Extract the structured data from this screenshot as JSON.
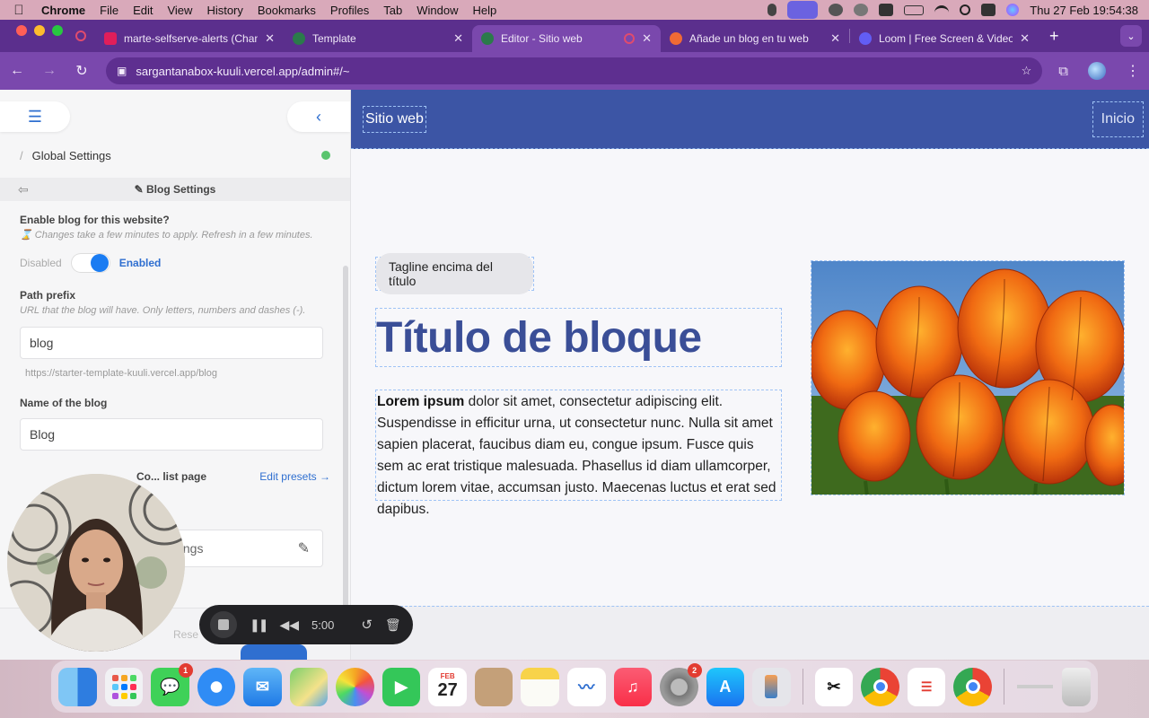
{
  "menubar": {
    "app_name": "Chrome",
    "items": [
      "File",
      "Edit",
      "View",
      "History",
      "Bookmarks",
      "Profiles",
      "Tab",
      "Window",
      "Help"
    ],
    "clock": "Thu 27 Feb  19:54:38"
  },
  "tabs": [
    {
      "title": "marte-selfserve-alerts (Chan",
      "favicon_color": "#e01e5a",
      "active": false
    },
    {
      "title": "Template",
      "favicon_color": "#2b7a4b",
      "active": false
    },
    {
      "title": "Editor - Sitio web",
      "favicon_color": "#2b7a4b",
      "active": true
    },
    {
      "title": "Añade un blog en tu web",
      "favicon_color": "#f06a35",
      "active": false
    },
    {
      "title": "Loom | Free Screen & Video R",
      "favicon_color": "#625df5",
      "active": false
    }
  ],
  "toolbar": {
    "url": "sargantanabox-kuuli.vercel.app/admin#/~"
  },
  "panel": {
    "breadcrumb": "Global Settings",
    "section_title": "✎ Blog Settings",
    "enable_label": "Enable blog for this website?",
    "enable_help": "⌛ Changes take a few minutes to apply. Refresh in a few minutes.",
    "toggle_off_label": "Disabled",
    "toggle_on_label": "Enabled",
    "path_label": "Path prefix",
    "path_help": "URL that the blog will have. Only letters, numbers and dashes (-).",
    "path_value": "blog",
    "path_url": "https://starter-template-kuuli.vercel.app/blog",
    "name_label": "Name of the blog",
    "name_value": "Blog",
    "presets_label": "Co... list page",
    "presets_link": "Edit presets →",
    "settings_row_label": "ttings",
    "reset_label": "Rese"
  },
  "recorder": {
    "time": "5:00"
  },
  "preview": {
    "site_title": "Sitio web",
    "nav_item": "Inicio",
    "tagline": "Tagline encima del título",
    "headline": "Título de bloque",
    "body_bold": "Lorem ipsum",
    "body_rest": " dolor sit amet, consectetur adipiscing elit. Suspendisse in efficitur urna, ut consectetur nunc. Nulla sit amet sapien placerat, faucibus diam eu, congue ipsum. Fusce quis sem ac erat tristique malesuada. Phasellus id diam ullamcorper, dictum lorem vitae, accumsan justo. Maecenas luctus et erat sed dapibus."
  },
  "dock": {
    "messages_badge": "1",
    "settings_badge": "2",
    "calendar_month": "FEB",
    "calendar_day": "27"
  },
  "colors": {
    "chrome_frame": "#5b2f8d",
    "chrome_toolbar": "#7a48ad",
    "site_header": "#3c55a5",
    "headline": "#3a4e97",
    "accent_blue": "#2f6fd0",
    "status_green": "#5ac46e"
  }
}
